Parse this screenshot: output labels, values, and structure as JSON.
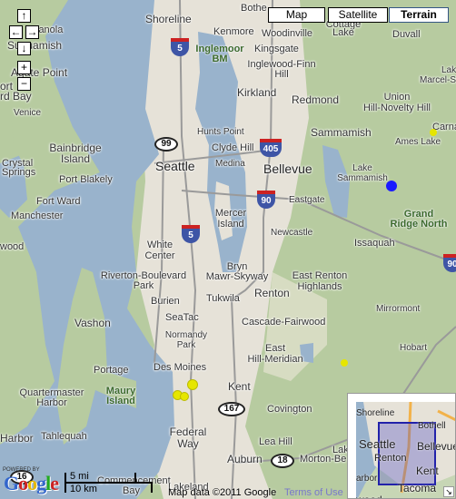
{
  "map_type_buttons": [
    {
      "label": "Map",
      "selected": false
    },
    {
      "label": "Satellite",
      "selected": false
    },
    {
      "label": "Terrain",
      "selected": true
    }
  ],
  "controls": {
    "pan_up": "↑",
    "pan_left": "←",
    "pan_right": "→",
    "pan_down": "↓",
    "zoom_in": "+",
    "zoom_out": "−"
  },
  "labels": [
    "ianola",
    "Suquamish",
    "Agate Point",
    "ort",
    "rd Bay",
    "Venice",
    "Bainbridge",
    "Island",
    "Crystal",
    "Springs",
    "Port Blakely",
    "Fort Ward",
    "Manchester",
    "wood",
    "Vashon",
    "Portage",
    "Quartermaster",
    "Harbor",
    "Maury",
    "Island",
    "Harbor",
    "Tahlequah",
    "Shoreline",
    "Kenmore",
    "Woodinville",
    "Cottage",
    "Lake",
    "Duvall",
    "Inglemoor",
    "BM",
    "Kingsgate",
    "Inglewood-Finn",
    "Hill",
    "Kirkland",
    "Redmond",
    "Lak",
    "Marcel-St",
    "Union",
    "Hill-Novelty Hill",
    "Sammamish",
    "Carna",
    "Ames Lake",
    "Hunts Point",
    "Clyde Hill",
    "Medina",
    "Seattle",
    "Bellevue",
    "Lake",
    "Sammamish",
    "Eastgate",
    "Mercer",
    "Island",
    "Grand",
    "Ridge North",
    "Newcastle",
    "Issaquah",
    "White",
    "Center",
    "Riverton-Boulevard",
    "Park",
    "Bryn",
    "Mawr-Skyway",
    "East Renton",
    "Highlands",
    "Renton",
    "Burien",
    "Tukwila",
    "Mirrormont",
    "SeaTac",
    "Cascade-Fairwood",
    "Normandy",
    "Park",
    "Hobart",
    "East",
    "Hill-Meridian",
    "Des Moines",
    "Kent",
    "Covington",
    "Federal",
    "Way",
    "Lea Hill",
    "Lake",
    "Auburn",
    "Morton-Be",
    "Commencement",
    "Bay",
    "Lakeland",
    "Bothe"
  ],
  "shields": {
    "i5": "5",
    "sr99": "99",
    "i405": "405",
    "i90": "90",
    "sr167": "167",
    "sr18": "18",
    "sr16": "16"
  },
  "markers": [
    {
      "color": "#1a1aff"
    },
    {
      "color": "#e6e600"
    }
  ],
  "footer": {
    "powered_by": "POWERED BY",
    "logo": "Google",
    "scale_mi": "5 mi",
    "scale_km": "10 km",
    "copyright": "Map data ©2011 Google",
    "terms": "Terms of Use"
  },
  "overview": {
    "labels": [
      "Shoreline",
      "Bothell",
      "Seattle",
      "Bellevue",
      "Renton",
      "Kent",
      "arbor",
      "Tacoma",
      "wood"
    ],
    "resize_icon": "↘"
  },
  "colors": {
    "water": "#99b3cc",
    "land": "#b7cba0",
    "urban": "#e9e5dc",
    "highway": "#f2b24a"
  }
}
